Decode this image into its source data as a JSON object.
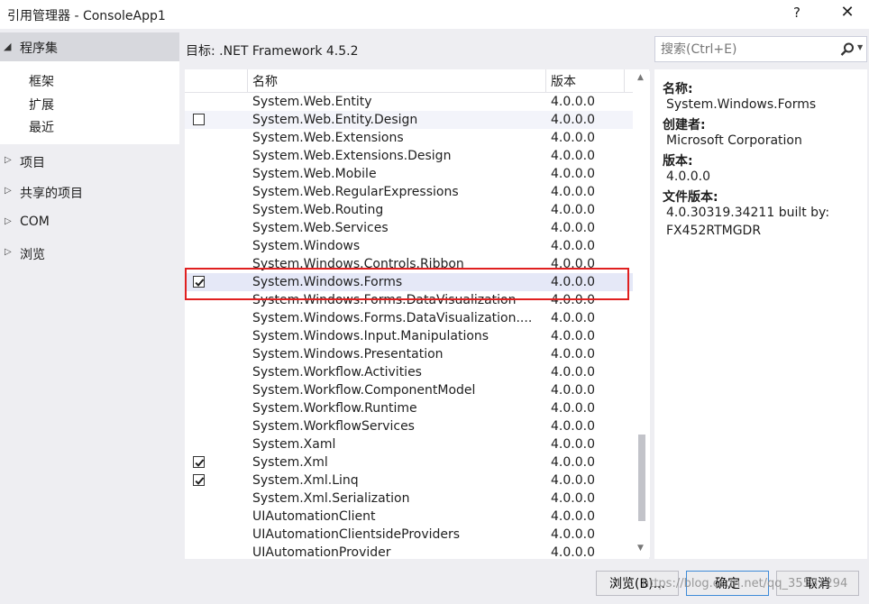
{
  "window": {
    "title": "引用管理器 - ConsoleApp1",
    "help": "?",
    "close": "✕"
  },
  "nav": {
    "assemblies": "程序集",
    "sub_items": [
      "框架",
      "扩展",
      "最近"
    ],
    "items": [
      "项目",
      "共享的项目",
      "COM",
      "浏览"
    ]
  },
  "target": "目标: .NET Framework 4.5.2",
  "columns": {
    "name": "名称",
    "version": "版本"
  },
  "rows": [
    {
      "name": "System.Web.Entity",
      "version": "4.0.0.0",
      "checked": false
    },
    {
      "name": "System.Web.Entity.Design",
      "version": "4.0.0.0",
      "checked": false
    },
    {
      "name": "System.Web.Extensions",
      "version": "4.0.0.0",
      "checked": false
    },
    {
      "name": "System.Web.Extensions.Design",
      "version": "4.0.0.0",
      "checked": false
    },
    {
      "name": "System.Web.Mobile",
      "version": "4.0.0.0",
      "checked": false
    },
    {
      "name": "System.Web.RegularExpressions",
      "version": "4.0.0.0",
      "checked": false
    },
    {
      "name": "System.Web.Routing",
      "version": "4.0.0.0",
      "checked": false
    },
    {
      "name": "System.Web.Services",
      "version": "4.0.0.0",
      "checked": false
    },
    {
      "name": "System.Windows",
      "version": "4.0.0.0",
      "checked": false
    },
    {
      "name": "System.Windows.Controls.Ribbon",
      "version": "4.0.0.0",
      "checked": false
    },
    {
      "name": "System.Windows.Forms",
      "version": "4.0.0.0",
      "checked": true
    },
    {
      "name": "System.Windows.Forms.DataVisualization",
      "version": "4.0.0.0",
      "checked": false
    },
    {
      "name": "System.Windows.Forms.DataVisualization....",
      "version": "4.0.0.0",
      "checked": false
    },
    {
      "name": "System.Windows.Input.Manipulations",
      "version": "4.0.0.0",
      "checked": false
    },
    {
      "name": "System.Windows.Presentation",
      "version": "4.0.0.0",
      "checked": false
    },
    {
      "name": "System.Workflow.Activities",
      "version": "4.0.0.0",
      "checked": false
    },
    {
      "name": "System.Workflow.ComponentModel",
      "version": "4.0.0.0",
      "checked": false
    },
    {
      "name": "System.Workflow.Runtime",
      "version": "4.0.0.0",
      "checked": false
    },
    {
      "name": "System.WorkflowServices",
      "version": "4.0.0.0",
      "checked": false
    },
    {
      "name": "System.Xaml",
      "version": "4.0.0.0",
      "checked": false
    },
    {
      "name": "System.Xml",
      "version": "4.0.0.0",
      "checked": true
    },
    {
      "name": "System.Xml.Linq",
      "version": "4.0.0.0",
      "checked": true
    },
    {
      "name": "System.Xml.Serialization",
      "version": "4.0.0.0",
      "checked": false
    },
    {
      "name": "UIAutomationClient",
      "version": "4.0.0.0",
      "checked": false
    },
    {
      "name": "UIAutomationClientsideProviders",
      "version": "4.0.0.0",
      "checked": false
    },
    {
      "name": "UIAutomationProvider",
      "version": "4.0.0.0",
      "checked": false
    }
  ],
  "search": {
    "placeholder": "搜索(Ctrl+E)",
    "icon": "search-icon"
  },
  "details": {
    "name_label": "名称:",
    "name_value": "System.Windows.Forms",
    "creator_label": "创建者:",
    "creator_value": "Microsoft Corporation",
    "version_label": "版本:",
    "version_value": "4.0.0.0",
    "file_version_label": "文件版本:",
    "file_version_value_1": "4.0.30319.34211 built by:",
    "file_version_value_2": "FX452RTMGDR"
  },
  "buttons": {
    "browse": "浏览(B)...",
    "ok": "确定",
    "cancel": "取消"
  },
  "watermark": "https://blog.csdn.net/qq_35581294",
  "colors": {
    "accent": "#3e8bd8",
    "highlight_border": "#e02020"
  }
}
